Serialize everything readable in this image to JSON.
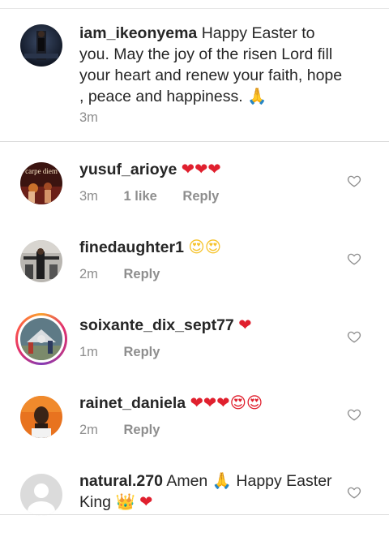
{
  "caption": {
    "username": "iam_ikeonyema",
    "text": "Happy Easter to you. May the joy of the risen Lord fill your heart and renew your faith, hope ,  peace and happiness.",
    "emoji": "🙏",
    "time": "3m"
  },
  "comments": [
    {
      "username": "yusuf_arioye",
      "text": "",
      "emoji": "❤❤❤",
      "time": "3m",
      "likes": "1 like",
      "reply": "Reply",
      "avatar_label": "carpe diem"
    },
    {
      "username": "finedaughter1",
      "text": "",
      "emoji": "😍😍",
      "time": "2m",
      "likes": "",
      "reply": "Reply"
    },
    {
      "username": "soixante_dix_sept77",
      "text": "",
      "emoji": "❤",
      "time": "1m",
      "likes": "",
      "reply": "Reply"
    },
    {
      "username": "rainet_daniela",
      "text": "",
      "emoji": "❤❤❤😍😍",
      "time": "2m",
      "likes": "",
      "reply": "Reply"
    },
    {
      "username": "natural.270",
      "text": "Amen",
      "emoji": "🙏",
      "text2": "Happy Easter King",
      "emoji2": "👑",
      "emoji3": "❤"
    }
  ],
  "colors": {
    "text": "#262626",
    "meta": "#8e8e8e",
    "heart": "#e0202e",
    "divider": "#dbdbdb"
  },
  "icons": {
    "like": "heart-outline-icon"
  }
}
